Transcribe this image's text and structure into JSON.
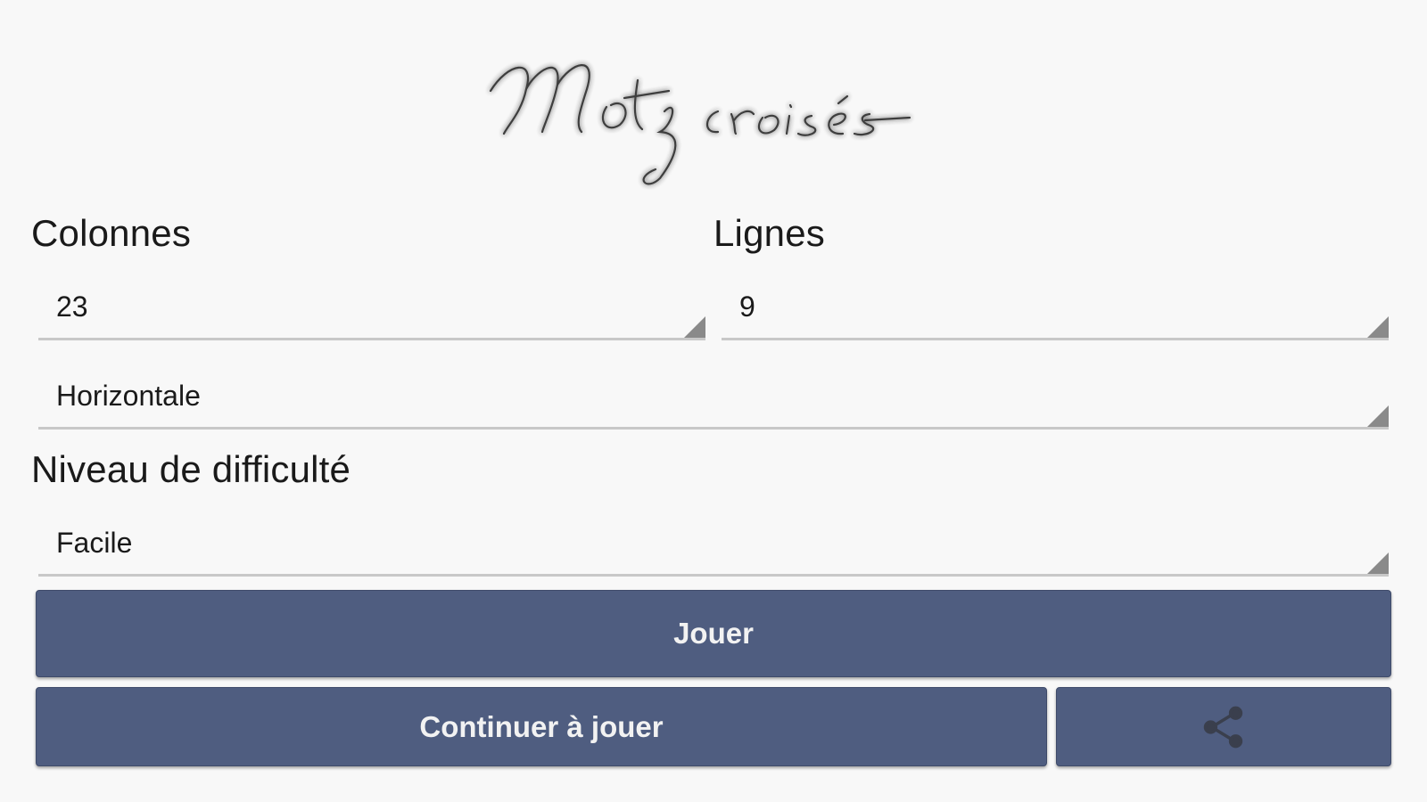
{
  "logo_text": "Mots croisés",
  "columns": {
    "label": "Colonnes",
    "value": "23"
  },
  "rows": {
    "label": "Lignes",
    "value": "9"
  },
  "orientation": {
    "value": "Horizontale"
  },
  "difficulty": {
    "label": "Niveau de difficulté",
    "value": "Facile"
  },
  "buttons": {
    "play": "Jouer",
    "continue": "Continuer à jouer",
    "share_icon": "share-icon"
  },
  "colors": {
    "button": "#4f5d80",
    "background": "#f8f8f8",
    "icon": "#3a3f4d"
  }
}
